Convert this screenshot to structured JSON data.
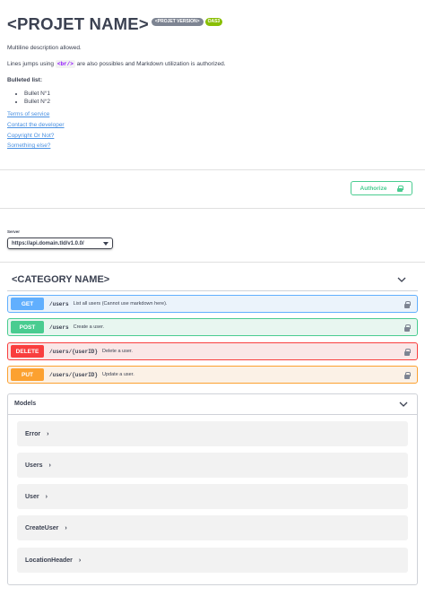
{
  "info": {
    "title": "<PROJET NAME>",
    "version_badge": "<PROJET VERSION>",
    "oas_badge": "OAS3",
    "description_line1": "Multiline description allowed.",
    "description_line2_prefix": "Lines jumps using",
    "description_line2_code": "<br/>",
    "description_line2_suffix": "are also possibles and Markdown utilization is authorized.",
    "bulleted_heading": "Bulleted list:",
    "bullets": [
      "Bullet N°1",
      "Bullet N°2"
    ],
    "links": [
      "Terms of service",
      "Contact the developer",
      "Copyright Or Not?",
      "Something else?"
    ]
  },
  "authorize": {
    "label": "Authorize"
  },
  "servers": {
    "label": "Server",
    "selected": "https://api.domain.tld/v1.0.0/"
  },
  "category": {
    "name": "<CATEGORY NAME>",
    "operations": [
      {
        "method": "GET",
        "path": "/users",
        "summary": "List all users (Cannot use markdown here).",
        "color": "#61affe",
        "bg": "#ebf3fb"
      },
      {
        "method": "POST",
        "path": "/users",
        "summary": "Create a user.",
        "color": "#49cc90",
        "bg": "#e8f6f0"
      },
      {
        "method": "DELETE",
        "path": "/users/{userID}",
        "summary": "Delete a user.",
        "color": "#f93e3e",
        "bg": "#fae7e7"
      },
      {
        "method": "PUT",
        "path": "/users/{userID}",
        "summary": "Update a user.",
        "color": "#fca130",
        "bg": "#fbf1e6"
      }
    ]
  },
  "models": {
    "title": "Models",
    "items": [
      "Error",
      "Users",
      "User",
      "CreateUser",
      "LocationHeader"
    ]
  }
}
